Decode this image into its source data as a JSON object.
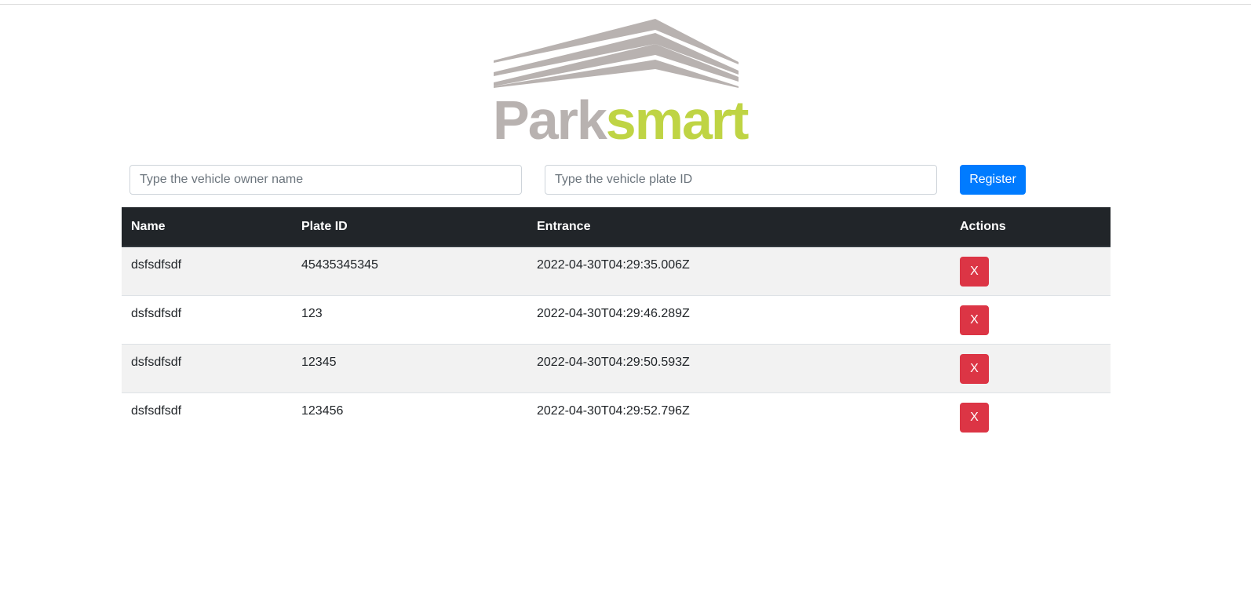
{
  "brand": {
    "logo_part1": "Park",
    "logo_part2": "smart",
    "colors": {
      "gray": "#b8b2b0",
      "green": "#bfd444"
    }
  },
  "form": {
    "owner_placeholder": "Type the vehicle owner name",
    "plate_placeholder": "Type the vehicle plate ID",
    "register_label": "Register"
  },
  "table": {
    "headers": {
      "name": "Name",
      "plate": "Plate ID",
      "entrance": "Entrance",
      "actions": "Actions"
    },
    "rows": [
      {
        "name": "dsfsdfsdf",
        "plate": "45435345345",
        "entrance": "2022-04-30T04:29:35.006Z",
        "action": "X"
      },
      {
        "name": "dsfsdfsdf",
        "plate": "123",
        "entrance": "2022-04-30T04:29:46.289Z",
        "action": "X"
      },
      {
        "name": "dsfsdfsdf",
        "plate": "12345",
        "entrance": "2022-04-30T04:29:50.593Z",
        "action": "X"
      },
      {
        "name": "dsfsdfsdf",
        "plate": "123456",
        "entrance": "2022-04-30T04:29:52.796Z",
        "action": "X"
      }
    ]
  },
  "colors": {
    "primary": "#007bff",
    "danger": "#dc3545",
    "header_dark": "#212529",
    "stripe": "#f2f2f2"
  }
}
